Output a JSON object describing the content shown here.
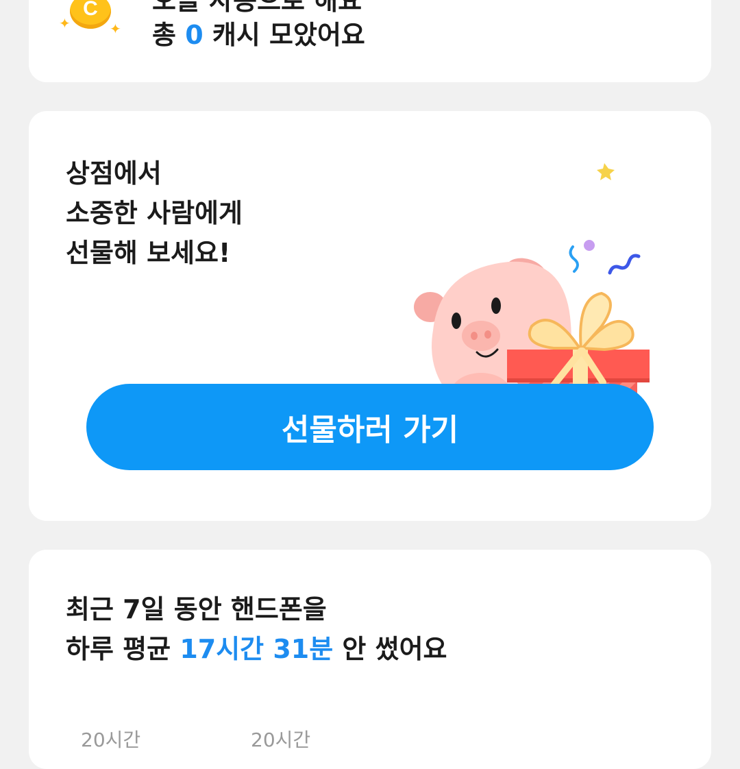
{
  "cash_card": {
    "top_line": "오늘 사용으로 해요",
    "total_prefix": "총",
    "total_value": "0",
    "total_suffix": "캐시 모았어요",
    "coin_letter": "C",
    "colors": {
      "coin": "#ffc21a",
      "accent": "#1d8cf0"
    },
    "icon": "coin-icon"
  },
  "gift_card": {
    "title_lines": [
      "상점에서",
      "소중한 사람에게",
      "선물해 보세요!"
    ],
    "button_label": "선물하러 가기",
    "button_color": "#0e98f7",
    "illustration": "pig-with-gift-illustration"
  },
  "stats_card": {
    "line1": "최근 7일 동안 핸드폰을",
    "line2_prefix": "하루 평균",
    "line2_highlight": "17시간 31분",
    "line2_suffix": "안 썼어요",
    "axis_labels": [
      "20시간",
      "20시간"
    ]
  }
}
